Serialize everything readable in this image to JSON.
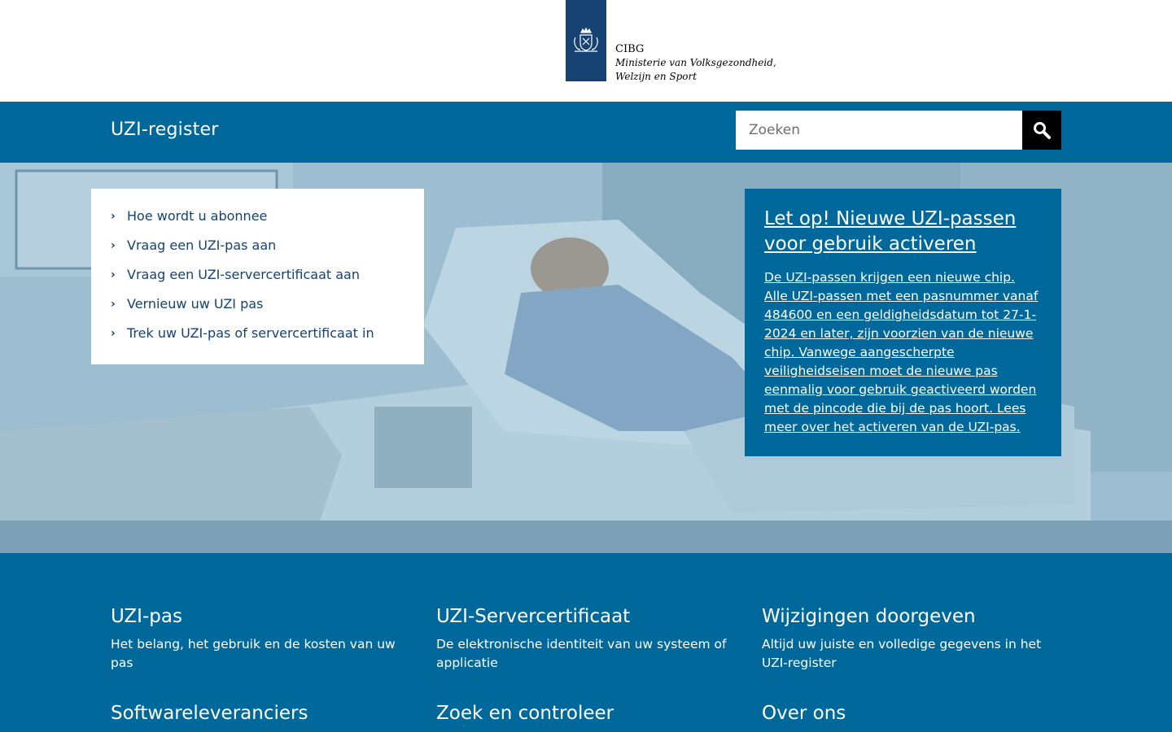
{
  "logo": {
    "icon": "royal-coat-of-arms-icon",
    "organization": "CIBG",
    "ministry_line1": "Ministerie van Volksgezondheid,",
    "ministry_line2": "Welzijn en Sport"
  },
  "header": {
    "site_title": "UZI-register",
    "search_placeholder": "Zoeken",
    "search_icon": "search-icon"
  },
  "quicklinks": [
    {
      "label": "Hoe wordt u abonnee"
    },
    {
      "label": "Vraag een UZI-pas aan"
    },
    {
      "label": "Vraag een UZI-servercertificaat aan"
    },
    {
      "label": "Vernieuw uw UZI pas"
    },
    {
      "label": "Trek uw UZI-pas of servercertificaat in"
    }
  ],
  "notice": {
    "title": "Let op! Nieuwe UZI-passen voor gebruik activeren",
    "body": "De UZI-passen krijgen een nieuwe chip. Alle UZI-passen met een pasnummer vanaf 484600 en een geldigheidsdatum tot 27-1-2024 en later, zijn voorzien van de nieuwe chip. Vanwege aangescherpte veiligheidseisen moet de nieuwe pas eenmalig voor gebruik geactiveerd worden met de pincode die bij de pas hoort. Lees meer over het activeren van de UZI-pas."
  },
  "tiles": [
    {
      "title": "UZI-pas",
      "description": "Het belang, het gebruik en de kosten van uw pas"
    },
    {
      "title": "UZI-Servercertificaat",
      "description": "De elektronische identiteit van uw systeem of applicatie"
    },
    {
      "title": "Wijzigingen doorgeven",
      "description": "Altijd uw juiste en volledige gegevens in het UZI-register"
    },
    {
      "title": "Softwareleveranciers",
      "description": ""
    },
    {
      "title": "Zoek en controleer",
      "description": ""
    },
    {
      "title": "Over ons",
      "description": ""
    }
  ],
  "colors": {
    "primary_blue": "#01689b",
    "dark_blue": "#154273",
    "white": "#ffffff",
    "black": "#000000"
  }
}
